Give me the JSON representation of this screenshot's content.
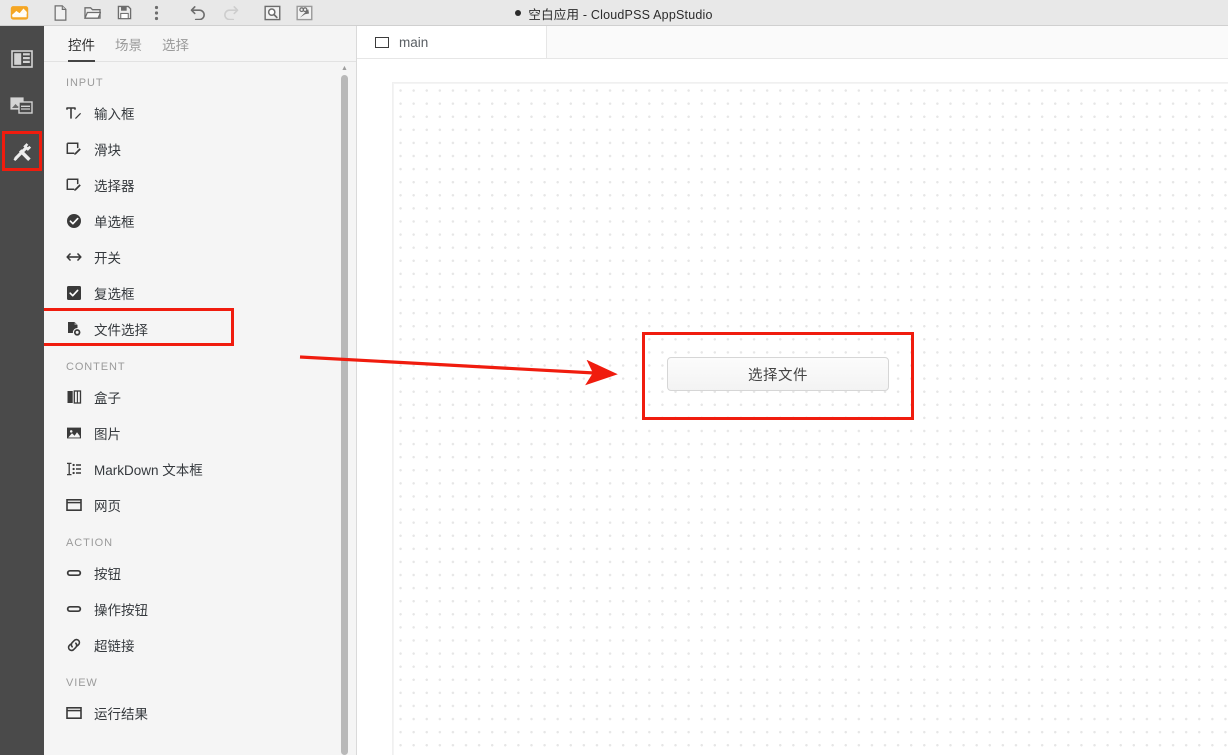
{
  "window": {
    "title": "空白应用 - CloudPSS AppStudio",
    "title_prefix_dot": "●",
    "app_name": "CloudPSS AppStudio",
    "document_name": "空白应用",
    "separator": "-"
  },
  "toolbar": {
    "logo": "cloudpss-logo-icon",
    "buttons": [
      {
        "name": "new-file-icon",
        "label": "新建"
      },
      {
        "name": "open-folder-icon",
        "label": "打开"
      },
      {
        "name": "save-icon",
        "label": "保存"
      },
      {
        "name": "more-options-icon",
        "label": "更多"
      },
      {
        "name": "undo-icon",
        "label": "撤销"
      },
      {
        "name": "redo-icon",
        "label": "重做"
      },
      {
        "name": "preview-icon",
        "label": "预览"
      },
      {
        "name": "publish-icon",
        "label": "发布"
      }
    ]
  },
  "rail": {
    "items": [
      {
        "name": "sidebar-item-layout",
        "icon": "layout-panel-icon",
        "active": false
      },
      {
        "name": "sidebar-item-resources",
        "icon": "media-resources-icon",
        "active": false
      },
      {
        "name": "sidebar-item-tools",
        "icon": "tools-icon",
        "active": true
      }
    ]
  },
  "panel": {
    "tabs": [
      {
        "label": "控件",
        "active": true
      },
      {
        "label": "场景",
        "active": false
      },
      {
        "label": "选择",
        "active": false
      }
    ],
    "groups": [
      {
        "title": "INPUT",
        "items": [
          {
            "label": "输入框",
            "icon": "text-input-icon",
            "highlighted": false
          },
          {
            "label": "滑块",
            "icon": "slider-icon",
            "highlighted": false
          },
          {
            "label": "选择器",
            "icon": "select-icon",
            "highlighted": false
          },
          {
            "label": "单选框",
            "icon": "radio-icon",
            "highlighted": false
          },
          {
            "label": "开关",
            "icon": "switch-icon",
            "highlighted": false
          },
          {
            "label": "复选框",
            "icon": "checkbox-icon",
            "highlighted": false
          },
          {
            "label": "文件选择",
            "icon": "file-picker-icon",
            "highlighted": true
          }
        ]
      },
      {
        "title": "CONTENT",
        "items": [
          {
            "label": "盒子",
            "icon": "box-icon",
            "highlighted": false
          },
          {
            "label": "图片",
            "icon": "image-icon",
            "highlighted": false
          },
          {
            "label": "MarkDown 文本框",
            "icon": "markdown-icon",
            "highlighted": false
          },
          {
            "label": "网页",
            "icon": "webpage-icon",
            "highlighted": false
          }
        ]
      },
      {
        "title": "ACTION",
        "items": [
          {
            "label": "按钮",
            "icon": "button-icon",
            "highlighted": false
          },
          {
            "label": "操作按钮",
            "icon": "action-button-icon",
            "highlighted": false
          },
          {
            "label": "超链接",
            "icon": "link-icon",
            "highlighted": false
          }
        ]
      },
      {
        "title": "VIEW",
        "items": [
          {
            "label": "运行结果",
            "icon": "result-view-icon",
            "highlighted": false
          }
        ]
      }
    ]
  },
  "editor": {
    "tabs": [
      {
        "label": "main",
        "icon": "page-icon",
        "active": true
      }
    ],
    "canvas": {
      "widget": {
        "type": "file-picker",
        "button_label": "选择文件",
        "annotated": true
      }
    }
  },
  "annotations": {
    "accent_color": "#f01c0e",
    "arrow": {
      "from": "文件选择",
      "to": "选择文件"
    }
  },
  "colors": {
    "titlebar_bg": "#e8e8e8",
    "rail_bg": "#4a4a4a",
    "panel_bg": "#f5f5f5",
    "canvas_bg": "#ffffff",
    "accent_red": "#f01c0e",
    "text_primary": "#35393d",
    "text_muted": "#9b9b9b"
  }
}
